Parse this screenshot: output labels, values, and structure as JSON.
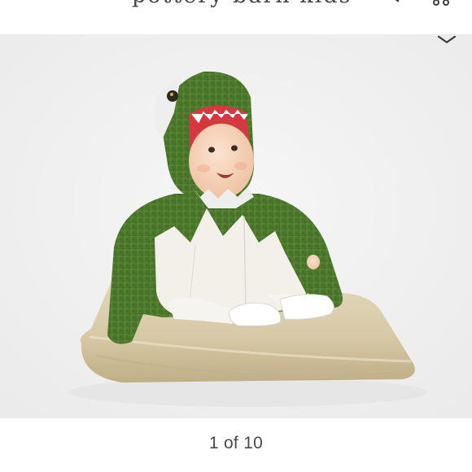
{
  "header": {
    "logo_text": "pottery barn kids",
    "icons": {
      "menu": "hamburger-menu-icon",
      "favorite": "heart-icon",
      "search": "search-icon",
      "bag": "shopping-bag-icon"
    }
  },
  "gallery": {
    "image_alt": "Baby in green dinosaur costume sitting on a burlap pillow",
    "counter": "1 of 10",
    "icons": {
      "collapse": "chevron-down-icon"
    }
  },
  "colors": {
    "background": "#ffffff",
    "photo_backdrop": "#f1f1f1",
    "costume_green": "#4f7a2e",
    "costume_white": "#f2efe8",
    "pillow_burlap": "#d9ccaa",
    "text": "#4a4a4a"
  }
}
